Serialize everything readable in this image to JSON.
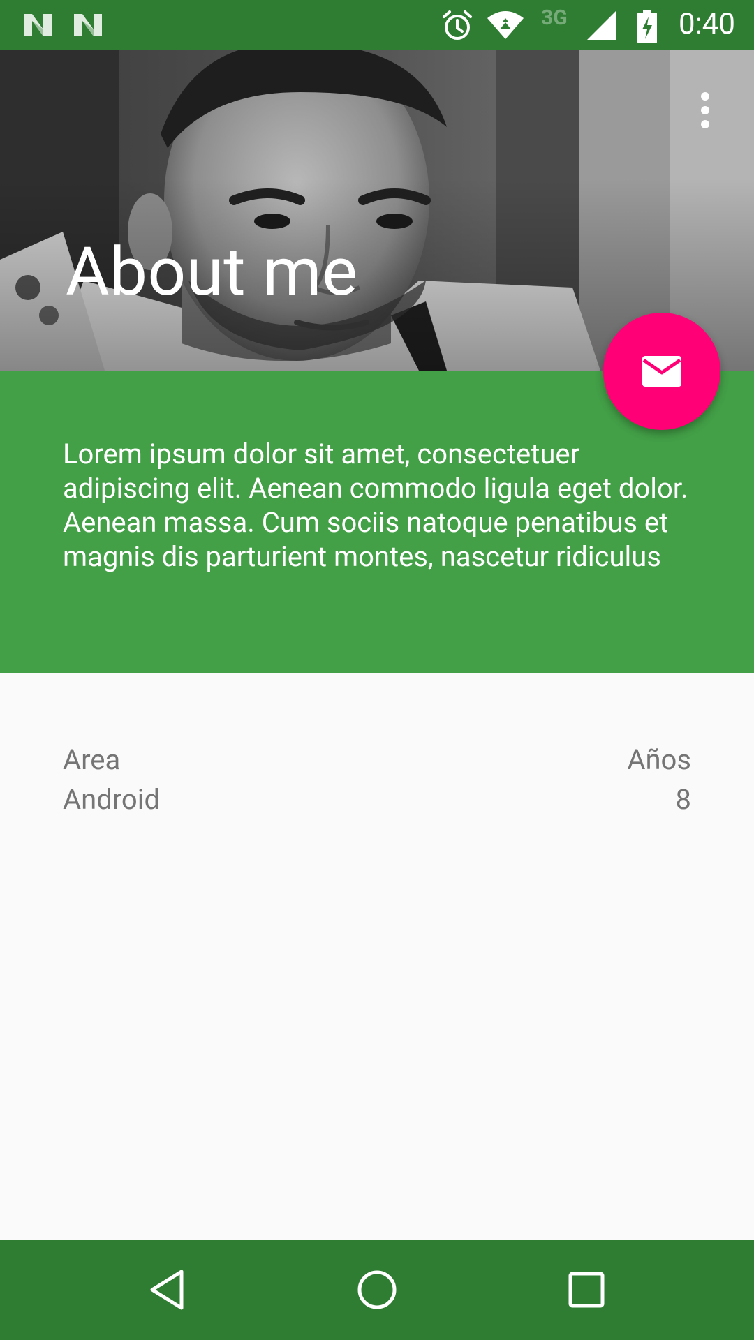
{
  "status_bar": {
    "network_label": "3G",
    "time": "0:40"
  },
  "header": {
    "title": "About me"
  },
  "bio": {
    "text": "Lorem ipsum dolor sit amet, consectetuer adipiscing elit. Aenean commodo ligula eget dolor. Aenean massa. Cum sociis natoque penatibus et magnis dis parturient montes, nascetur ridiculus"
  },
  "info_table": {
    "headers": {
      "left": "Area",
      "right": "Años"
    },
    "rows": [
      {
        "left": "Android",
        "right": "8"
      }
    ]
  },
  "colors": {
    "status_bar": "#2e7d32",
    "accent_green": "#43a047",
    "fab": "#ff0077",
    "background": "#fafafa",
    "secondary_text": "#757575"
  },
  "icons": {
    "notification_1": "n-notification-icon",
    "notification_2": "n-notification-icon",
    "alarm": "alarm-icon",
    "wifi": "wifi-icon",
    "signal": "signal-icon",
    "battery": "battery-charging-icon",
    "overflow": "more-vert-icon",
    "fab": "mail-icon",
    "nav_back": "back-icon",
    "nav_home": "home-icon",
    "nav_recents": "recents-icon"
  }
}
